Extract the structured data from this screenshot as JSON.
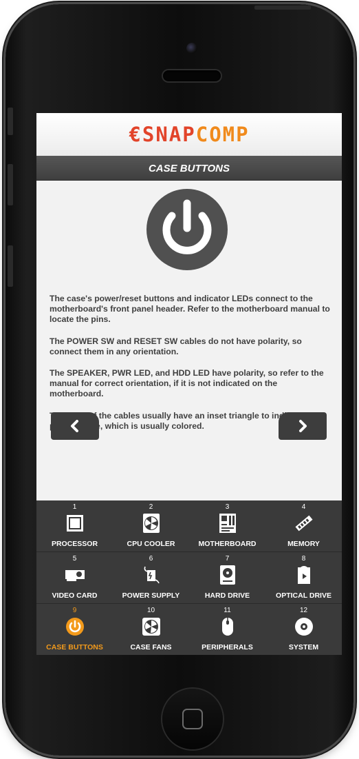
{
  "app": {
    "logo_part1": "€SNAP",
    "logo_part2": "COMP",
    "page_title": "CASE BUTTONS"
  },
  "main": {
    "hero_icon": "power-icon",
    "paragraphs": [
      "The case's power/reset buttons and indicator LEDs connect to the motherboard's front panel header. Refer to the motherboard manual to locate the pins.",
      "The POWER SW and RESET SW cables do not have polarity, so connect them in any orientation.",
      "The SPEAKER, PWR LED, and HDD LED have polarity, so refer to the manual for correct orientation, if it is not indicated on the motherboard.",
      "The ends of the cables usually have an inset triangle to indicate the positive wire, which is usually colored."
    ],
    "prev_icon": "chevron-left-icon",
    "next_icon": "chevron-right-icon"
  },
  "nav": {
    "active_index": 9,
    "items": [
      {
        "num": "1",
        "label": "PROCESSOR",
        "icon": "processor-icon"
      },
      {
        "num": "2",
        "label": "CPU COOLER",
        "icon": "cpu-cooler-icon"
      },
      {
        "num": "3",
        "label": "MOTHERBOARD",
        "icon": "motherboard-icon"
      },
      {
        "num": "4",
        "label": "MEMORY",
        "icon": "memory-icon"
      },
      {
        "num": "5",
        "label": "VIDEO CARD",
        "icon": "video-card-icon"
      },
      {
        "num": "6",
        "label": "POWER SUPPLY",
        "icon": "power-supply-icon"
      },
      {
        "num": "7",
        "label": "HARD DRIVE",
        "icon": "hard-drive-icon"
      },
      {
        "num": "8",
        "label": "OPTICAL DRIVE",
        "icon": "optical-drive-icon"
      },
      {
        "num": "9",
        "label": "CASE BUTTONS",
        "icon": "power-icon"
      },
      {
        "num": "10",
        "label": "CASE FANS",
        "icon": "fan-icon"
      },
      {
        "num": "11",
        "label": "PERIPHERALS",
        "icon": "mouse-icon"
      },
      {
        "num": "12",
        "label": "SYSTEM",
        "icon": "system-icon"
      }
    ]
  },
  "colors": {
    "accent": "#f39a1b",
    "logo_red": "#e2442a",
    "logo_orange": "#f08a1c",
    "nav_bg": "#3a3a3a",
    "text": "#3f3f3f"
  }
}
